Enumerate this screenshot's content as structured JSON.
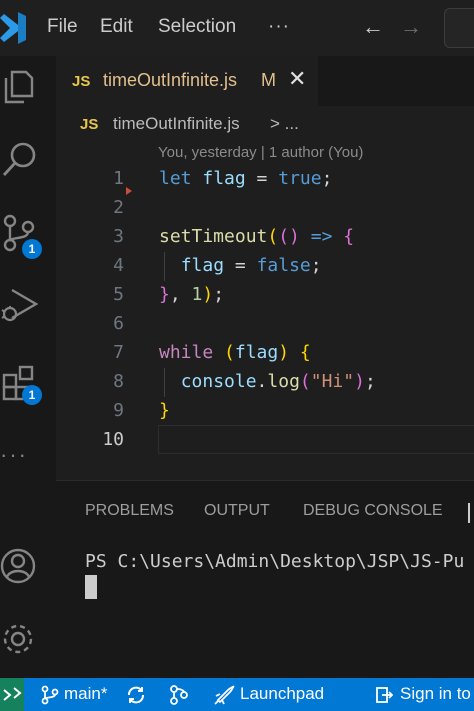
{
  "menu": {
    "file": "File",
    "edit": "Edit",
    "selection": "Selection",
    "more": "···"
  },
  "nav": {
    "back": "←",
    "forward": "→"
  },
  "activity": {
    "scm_badge": "1",
    "extensions_badge": "1",
    "more": "···"
  },
  "tab": {
    "lang": "JS",
    "name": "timeOutInfinite.js",
    "modified": "M",
    "close": "✕"
  },
  "breadcrumb": {
    "lang": "JS",
    "file": "timeOutInfinite.js",
    "chevron": "> ..."
  },
  "codelens": "You, yesterday | 1 author (You)",
  "line_numbers": [
    "1",
    "2",
    "3",
    "4",
    "5",
    "6",
    "7",
    "8",
    "9",
    "10"
  ],
  "code": {
    "l1": {
      "kw": "let",
      "var": "flag",
      "op": " = ",
      "val": "true",
      "end": ";"
    },
    "l3": {
      "fn": "setTimeout",
      "p1": "(",
      "p2": "()",
      "arrow": " => ",
      "b": "{"
    },
    "l4": {
      "var": "flag",
      "op": " = ",
      "val": "false",
      "end": ";"
    },
    "l5": {
      "b": "}",
      "comma": ", ",
      "num": "1",
      "p": ")",
      "end": ";"
    },
    "l7": {
      "kw": "while",
      "p1": " (",
      "var": "flag",
      "p2": ")",
      "b": " {"
    },
    "l8": {
      "obj": "console",
      "dot": ".",
      "fn": "log",
      "p1": "(",
      "str": "\"Hi\"",
      "p2": ")",
      "end": ";"
    },
    "l9": {
      "b": "}"
    }
  },
  "panel": {
    "tabs": [
      "PROBLEMS",
      "OUTPUT",
      "DEBUG CONSOLE"
    ],
    "terminal_prompt": "PS C:\\Users\\Admin\\Desktop\\JSP\\JS-Pu"
  },
  "status": {
    "branch": "main*",
    "launchpad": "Launchpad",
    "signin": "Sign in to"
  },
  "colors": {
    "accent": "#0078d4",
    "remote": "#16825d",
    "modified": "#e2c08d"
  }
}
